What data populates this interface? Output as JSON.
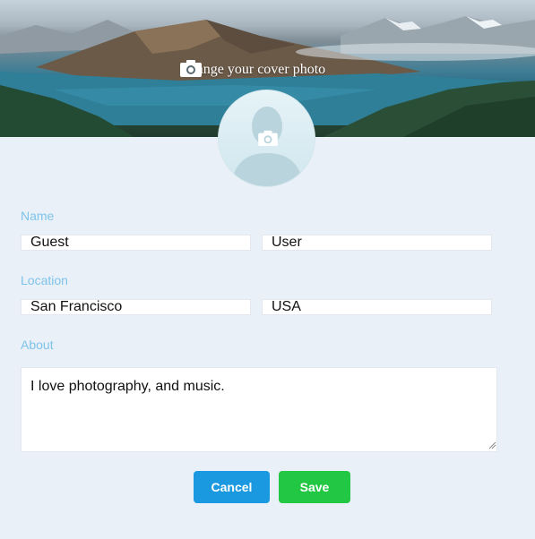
{
  "cover": {
    "cta_label": "Change your cover photo",
    "cta_icon": "camera-icon"
  },
  "avatar": {
    "icon": "camera-icon",
    "placeholder": "person-silhouette"
  },
  "form": {
    "name": {
      "label": "Name",
      "first": "Guest",
      "last": "User"
    },
    "location": {
      "label": "Location",
      "city": "San Francisco",
      "country": "USA"
    },
    "about": {
      "label": "About",
      "value": "I love photography, and music."
    }
  },
  "actions": {
    "cancel_label": "Cancel",
    "save_label": "Save"
  },
  "colors": {
    "page_bg": "#eaf0f7",
    "label": "#7ec3e9",
    "cancel": "#1a99e0",
    "save": "#22c744"
  }
}
